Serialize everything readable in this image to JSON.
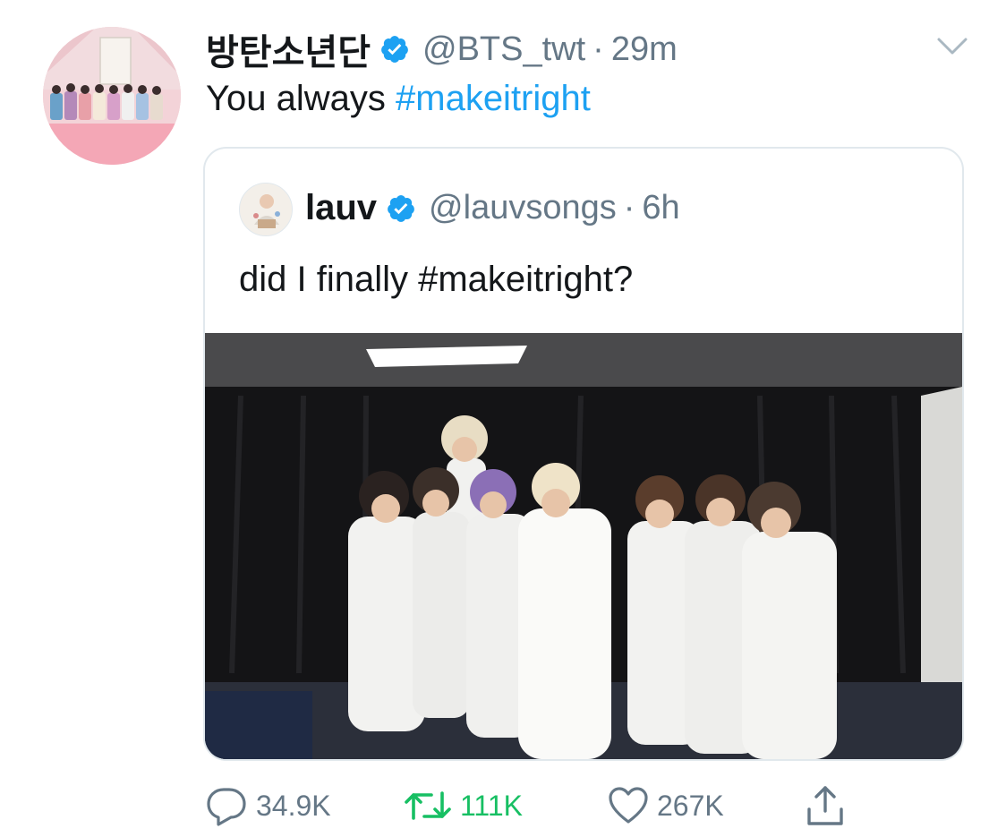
{
  "tweet": {
    "display_name": "방탄소년단",
    "handle": "@BTS_twt",
    "separator": "·",
    "time": "29m",
    "text_plain": "You always ",
    "text_hashtag": "#makeitright",
    "avatar_icon": "bts-group-avatar",
    "verified_icon": "verified-badge-icon",
    "menu_icon": "chevron-down-icon"
  },
  "quoted": {
    "display_name": "lauv",
    "handle": "@lauvsongs",
    "separator": "·",
    "time": "6h",
    "text": "did I finally #makeitright?",
    "avatar_icon": "lauv-avatar",
    "verified_icon": "verified-badge-icon",
    "media_icon": "group-photo"
  },
  "actions": {
    "replies": "34.9K",
    "retweets": "111K",
    "likes": "267K",
    "reply_icon": "reply-icon",
    "retweet_icon": "retweet-icon",
    "like_icon": "heart-icon",
    "share_icon": "share-icon"
  },
  "colors": {
    "accent": "#1da1f2",
    "retweet": "#17bf63",
    "muted": "#657786",
    "text": "#14171a",
    "border": "#e1e8ed"
  }
}
